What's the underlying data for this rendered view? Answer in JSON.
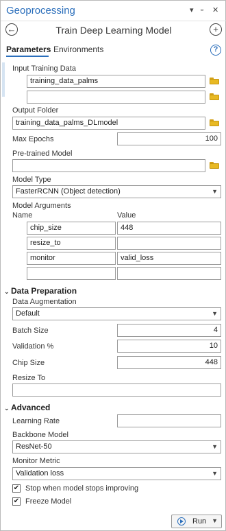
{
  "app_title": "Geoprocessing",
  "window_controls": {
    "dropdown": "▾",
    "pin": "▫",
    "close": "✕"
  },
  "tool_title": "Train Deep Learning Model",
  "tabs": [
    {
      "label": "Parameters"
    },
    {
      "label": "Environments"
    }
  ],
  "help": "?",
  "params": {
    "input_training_data": {
      "label": "Input Training Data",
      "values": [
        "training_data_palms",
        ""
      ]
    },
    "output_folder": {
      "label": "Output Folder",
      "value": "training_data_palms_DLmodel"
    },
    "max_epochs": {
      "label": "Max Epochs",
      "value": "100"
    },
    "pretrained_model": {
      "label": "Pre-trained Model",
      "value": ""
    },
    "model_type": {
      "label": "Model Type",
      "value": "FasterRCNN (Object detection)"
    },
    "model_arguments": {
      "label": "Model Arguments",
      "col_name": "Name",
      "col_value": "Value",
      "rows": [
        {
          "name": "chip_size",
          "value": "448"
        },
        {
          "name": "resize_to",
          "value": ""
        },
        {
          "name": "monitor",
          "value": "valid_loss"
        },
        {
          "name": "",
          "value": ""
        }
      ]
    }
  },
  "data_preparation": {
    "header": "Data Preparation",
    "data_augmentation": {
      "label": "Data Augmentation",
      "value": "Default"
    },
    "batch_size": {
      "label": "Batch Size",
      "value": "4"
    },
    "validation_pct": {
      "label": "Validation %",
      "value": "10"
    },
    "chip_size": {
      "label": "Chip Size",
      "value": "448"
    },
    "resize_to": {
      "label": "Resize To",
      "value": ""
    }
  },
  "advanced": {
    "header": "Advanced",
    "learning_rate": {
      "label": "Learning Rate",
      "value": ""
    },
    "backbone_model": {
      "label": "Backbone Model",
      "value": "ResNet-50"
    },
    "monitor_metric": {
      "label": "Monitor Metric",
      "value": "Validation loss"
    },
    "stop_improving": {
      "label": "Stop when model stops improving",
      "checked": true
    },
    "freeze_model": {
      "label": "Freeze Model",
      "checked": true
    }
  },
  "run_button": {
    "label": "Run"
  },
  "colors": {
    "accent": "#2a6ebb",
    "folder": "#e8b923",
    "border": "#9a9a9a"
  },
  "icons": [
    "back-arrow-icon",
    "add-icon",
    "help-icon",
    "folder-icon",
    "chevron-down-icon",
    "checkbox-checked-icon",
    "run-icon"
  ]
}
